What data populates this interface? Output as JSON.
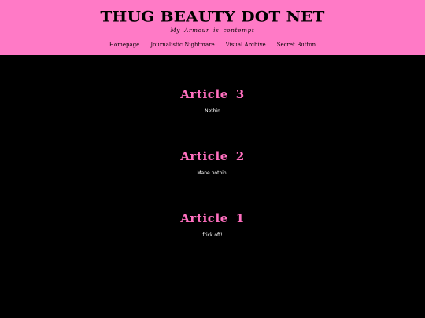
{
  "header": {
    "title": "THUG BEAUTY DOT NET",
    "tagline": "My Armour is contempt",
    "background_color": "#ff7ac6"
  },
  "nav": {
    "items": [
      {
        "label": "Homepage"
      },
      {
        "label": "Journalistic Nightmare"
      },
      {
        "label": "Visual Archive"
      },
      {
        "label": "Secret Button"
      }
    ]
  },
  "articles": [
    {
      "title": "Article 3",
      "body": "Nothin"
    },
    {
      "title": "Article 2",
      "body": "Mane nothin."
    },
    {
      "title": "Article 1",
      "body": "frick off!"
    }
  ],
  "colors": {
    "page_background": "#000000",
    "article_title": "#ff6fbf",
    "article_body": "#ffffff"
  }
}
